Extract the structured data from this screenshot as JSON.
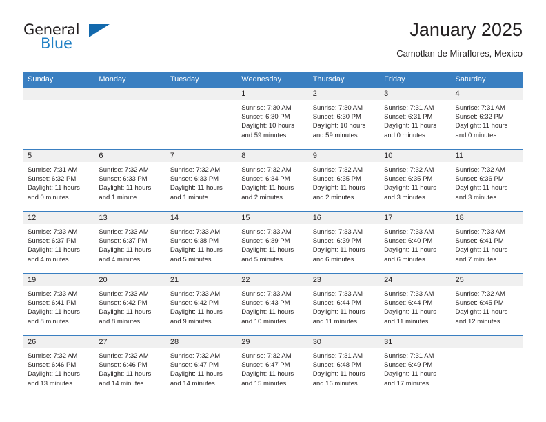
{
  "brand": {
    "name_part1": "General",
    "name_part2": "Blue",
    "logo_icon": "triangle-logo-icon",
    "accent_color": "#1369ad"
  },
  "header": {
    "title": "January 2025",
    "subtitle": "Camotlan de Miraflores, Mexico"
  },
  "calendar": {
    "header_color": "#3a7fc1",
    "daynum_band_color": "#f0f0f0",
    "weekdays": [
      "Sunday",
      "Monday",
      "Tuesday",
      "Wednesday",
      "Thursday",
      "Friday",
      "Saturday"
    ],
    "weeks": [
      [
        {
          "day": "",
          "empty": true
        },
        {
          "day": "",
          "empty": true
        },
        {
          "day": "",
          "empty": true
        },
        {
          "day": "1",
          "sunrise": "Sunrise: 7:30 AM",
          "sunset": "Sunset: 6:30 PM",
          "daylight1": "Daylight: 10 hours",
          "daylight2": "and 59 minutes."
        },
        {
          "day": "2",
          "sunrise": "Sunrise: 7:30 AM",
          "sunset": "Sunset: 6:30 PM",
          "daylight1": "Daylight: 10 hours",
          "daylight2": "and 59 minutes."
        },
        {
          "day": "3",
          "sunrise": "Sunrise: 7:31 AM",
          "sunset": "Sunset: 6:31 PM",
          "daylight1": "Daylight: 11 hours",
          "daylight2": "and 0 minutes."
        },
        {
          "day": "4",
          "sunrise": "Sunrise: 7:31 AM",
          "sunset": "Sunset: 6:32 PM",
          "daylight1": "Daylight: 11 hours",
          "daylight2": "and 0 minutes."
        }
      ],
      [
        {
          "day": "5",
          "sunrise": "Sunrise: 7:31 AM",
          "sunset": "Sunset: 6:32 PM",
          "daylight1": "Daylight: 11 hours",
          "daylight2": "and 0 minutes."
        },
        {
          "day": "6",
          "sunrise": "Sunrise: 7:32 AM",
          "sunset": "Sunset: 6:33 PM",
          "daylight1": "Daylight: 11 hours",
          "daylight2": "and 1 minute."
        },
        {
          "day": "7",
          "sunrise": "Sunrise: 7:32 AM",
          "sunset": "Sunset: 6:33 PM",
          "daylight1": "Daylight: 11 hours",
          "daylight2": "and 1 minute."
        },
        {
          "day": "8",
          "sunrise": "Sunrise: 7:32 AM",
          "sunset": "Sunset: 6:34 PM",
          "daylight1": "Daylight: 11 hours",
          "daylight2": "and 2 minutes."
        },
        {
          "day": "9",
          "sunrise": "Sunrise: 7:32 AM",
          "sunset": "Sunset: 6:35 PM",
          "daylight1": "Daylight: 11 hours",
          "daylight2": "and 2 minutes."
        },
        {
          "day": "10",
          "sunrise": "Sunrise: 7:32 AM",
          "sunset": "Sunset: 6:35 PM",
          "daylight1": "Daylight: 11 hours",
          "daylight2": "and 3 minutes."
        },
        {
          "day": "11",
          "sunrise": "Sunrise: 7:32 AM",
          "sunset": "Sunset: 6:36 PM",
          "daylight1": "Daylight: 11 hours",
          "daylight2": "and 3 minutes."
        }
      ],
      [
        {
          "day": "12",
          "sunrise": "Sunrise: 7:33 AM",
          "sunset": "Sunset: 6:37 PM",
          "daylight1": "Daylight: 11 hours",
          "daylight2": "and 4 minutes."
        },
        {
          "day": "13",
          "sunrise": "Sunrise: 7:33 AM",
          "sunset": "Sunset: 6:37 PM",
          "daylight1": "Daylight: 11 hours",
          "daylight2": "and 4 minutes."
        },
        {
          "day": "14",
          "sunrise": "Sunrise: 7:33 AM",
          "sunset": "Sunset: 6:38 PM",
          "daylight1": "Daylight: 11 hours",
          "daylight2": "and 5 minutes."
        },
        {
          "day": "15",
          "sunrise": "Sunrise: 7:33 AM",
          "sunset": "Sunset: 6:39 PM",
          "daylight1": "Daylight: 11 hours",
          "daylight2": "and 5 minutes."
        },
        {
          "day": "16",
          "sunrise": "Sunrise: 7:33 AM",
          "sunset": "Sunset: 6:39 PM",
          "daylight1": "Daylight: 11 hours",
          "daylight2": "and 6 minutes."
        },
        {
          "day": "17",
          "sunrise": "Sunrise: 7:33 AM",
          "sunset": "Sunset: 6:40 PM",
          "daylight1": "Daylight: 11 hours",
          "daylight2": "and 6 minutes."
        },
        {
          "day": "18",
          "sunrise": "Sunrise: 7:33 AM",
          "sunset": "Sunset: 6:41 PM",
          "daylight1": "Daylight: 11 hours",
          "daylight2": "and 7 minutes."
        }
      ],
      [
        {
          "day": "19",
          "sunrise": "Sunrise: 7:33 AM",
          "sunset": "Sunset: 6:41 PM",
          "daylight1": "Daylight: 11 hours",
          "daylight2": "and 8 minutes."
        },
        {
          "day": "20",
          "sunrise": "Sunrise: 7:33 AM",
          "sunset": "Sunset: 6:42 PM",
          "daylight1": "Daylight: 11 hours",
          "daylight2": "and 8 minutes."
        },
        {
          "day": "21",
          "sunrise": "Sunrise: 7:33 AM",
          "sunset": "Sunset: 6:42 PM",
          "daylight1": "Daylight: 11 hours",
          "daylight2": "and 9 minutes."
        },
        {
          "day": "22",
          "sunrise": "Sunrise: 7:33 AM",
          "sunset": "Sunset: 6:43 PM",
          "daylight1": "Daylight: 11 hours",
          "daylight2": "and 10 minutes."
        },
        {
          "day": "23",
          "sunrise": "Sunrise: 7:33 AM",
          "sunset": "Sunset: 6:44 PM",
          "daylight1": "Daylight: 11 hours",
          "daylight2": "and 11 minutes."
        },
        {
          "day": "24",
          "sunrise": "Sunrise: 7:33 AM",
          "sunset": "Sunset: 6:44 PM",
          "daylight1": "Daylight: 11 hours",
          "daylight2": "and 11 minutes."
        },
        {
          "day": "25",
          "sunrise": "Sunrise: 7:32 AM",
          "sunset": "Sunset: 6:45 PM",
          "daylight1": "Daylight: 11 hours",
          "daylight2": "and 12 minutes."
        }
      ],
      [
        {
          "day": "26",
          "sunrise": "Sunrise: 7:32 AM",
          "sunset": "Sunset: 6:46 PM",
          "daylight1": "Daylight: 11 hours",
          "daylight2": "and 13 minutes."
        },
        {
          "day": "27",
          "sunrise": "Sunrise: 7:32 AM",
          "sunset": "Sunset: 6:46 PM",
          "daylight1": "Daylight: 11 hours",
          "daylight2": "and 14 minutes."
        },
        {
          "day": "28",
          "sunrise": "Sunrise: 7:32 AM",
          "sunset": "Sunset: 6:47 PM",
          "daylight1": "Daylight: 11 hours",
          "daylight2": "and 14 minutes."
        },
        {
          "day": "29",
          "sunrise": "Sunrise: 7:32 AM",
          "sunset": "Sunset: 6:47 PM",
          "daylight1": "Daylight: 11 hours",
          "daylight2": "and 15 minutes."
        },
        {
          "day": "30",
          "sunrise": "Sunrise: 7:31 AM",
          "sunset": "Sunset: 6:48 PM",
          "daylight1": "Daylight: 11 hours",
          "daylight2": "and 16 minutes."
        },
        {
          "day": "31",
          "sunrise": "Sunrise: 7:31 AM",
          "sunset": "Sunset: 6:49 PM",
          "daylight1": "Daylight: 11 hours",
          "daylight2": "and 17 minutes."
        },
        {
          "day": "",
          "empty": true
        }
      ]
    ]
  }
}
